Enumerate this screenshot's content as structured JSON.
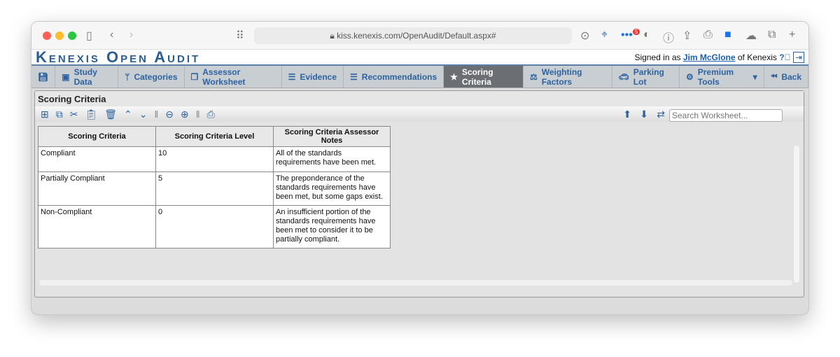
{
  "browser": {
    "url": "kiss.kenexis.com/OpenAudit/Default.aspx#",
    "badge_count": "5"
  },
  "header": {
    "logo": "Kenexis Open Audit",
    "signed_prefix": "Signed in as ",
    "user": "Jim McGlone",
    "signed_suffix": " of Kenexis"
  },
  "tabs": [
    {
      "label": "",
      "icon": "save-icon"
    },
    {
      "label": "Study Data",
      "icon": "id-card-icon"
    },
    {
      "label": "Categories",
      "icon": "fork-icon"
    },
    {
      "label": "Assessor Worksheet",
      "icon": "copy-icon"
    },
    {
      "label": "Evidence",
      "icon": "list-icon"
    },
    {
      "label": "Recommendations",
      "icon": "list-icon"
    },
    {
      "label": "Scoring Criteria",
      "icon": "star-icon",
      "active": true
    },
    {
      "label": "Weighting Factors",
      "icon": "scale-icon"
    },
    {
      "label": "Parking Lot",
      "icon": "car-icon"
    },
    {
      "label": "Premium Tools",
      "icon": "gears-icon"
    },
    {
      "label": "Back",
      "icon": "back-icon"
    }
  ],
  "panel": {
    "title": "Scoring Criteria",
    "search_placeholder": "Search Worksheet..."
  },
  "table": {
    "headers": [
      "Scoring Criteria",
      "Scoring Criteria Level",
      "Scoring Criteria Assessor Notes"
    ],
    "rows": [
      [
        "Compliant",
        "10",
        "All of the standards requirements have been met."
      ],
      [
        "Partially Compliant",
        "5",
        "The preponderance of the standards requirements have been met, but some gaps exist."
      ],
      [
        "Non-Compliant",
        "0",
        "An insufficient portion of the standards requirements have been met to consider it to be partially compliant."
      ]
    ]
  },
  "colors": {
    "accent": "#2c62a0",
    "active_tab": "#6b6f73"
  }
}
